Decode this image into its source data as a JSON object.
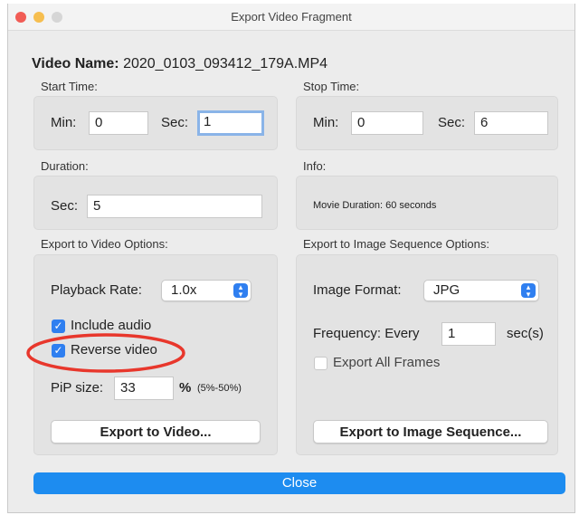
{
  "window": {
    "title": "Export Video Fragment"
  },
  "video_name": {
    "label": "Video Name:",
    "value": "2020_0103_093412_179A.MP4"
  },
  "start_time": {
    "label": "Start Time:",
    "min_label": "Min:",
    "min_value": "0",
    "sec_label": "Sec:",
    "sec_value": "1"
  },
  "stop_time": {
    "label": "Stop Time:",
    "min_label": "Min:",
    "min_value": "0",
    "sec_label": "Sec:",
    "sec_value": "6"
  },
  "duration": {
    "label": "Duration:",
    "sec_label": "Sec:",
    "sec_value": "5"
  },
  "info": {
    "label": "Info:",
    "text": "Movie Duration: 60 seconds"
  },
  "video_options": {
    "label": "Export to Video Options:",
    "playback_label": "Playback Rate:",
    "playback_value": "1.0x",
    "include_audio": {
      "label": "Include audio",
      "checked": true
    },
    "reverse_video": {
      "label": "Reverse video",
      "checked": true
    },
    "pip_label": "PiP size:",
    "pip_value": "33",
    "pip_unit": "%",
    "pip_range": "(5%-50%)",
    "export_button": "Export to Video..."
  },
  "image_options": {
    "label": "Export to Image Sequence Options:",
    "format_label": "Image Format:",
    "format_value": "JPG",
    "frequency_label": "Frequency: Every",
    "frequency_value": "1",
    "frequency_unit": "sec(s)",
    "all_frames": {
      "label": "Export All Frames",
      "checked": false
    },
    "export_button": "Export to Image Sequence..."
  },
  "close_button": "Close",
  "colors": {
    "accent": "#2f7ff0",
    "close_button": "#1d8cf0",
    "annotation": "#e8372c",
    "traffic_red": "#f15c55",
    "traffic_yellow": "#f6be4f"
  },
  "icons": {
    "stepper": "chevron-up-down-icon",
    "check": "checkmark-icon"
  }
}
